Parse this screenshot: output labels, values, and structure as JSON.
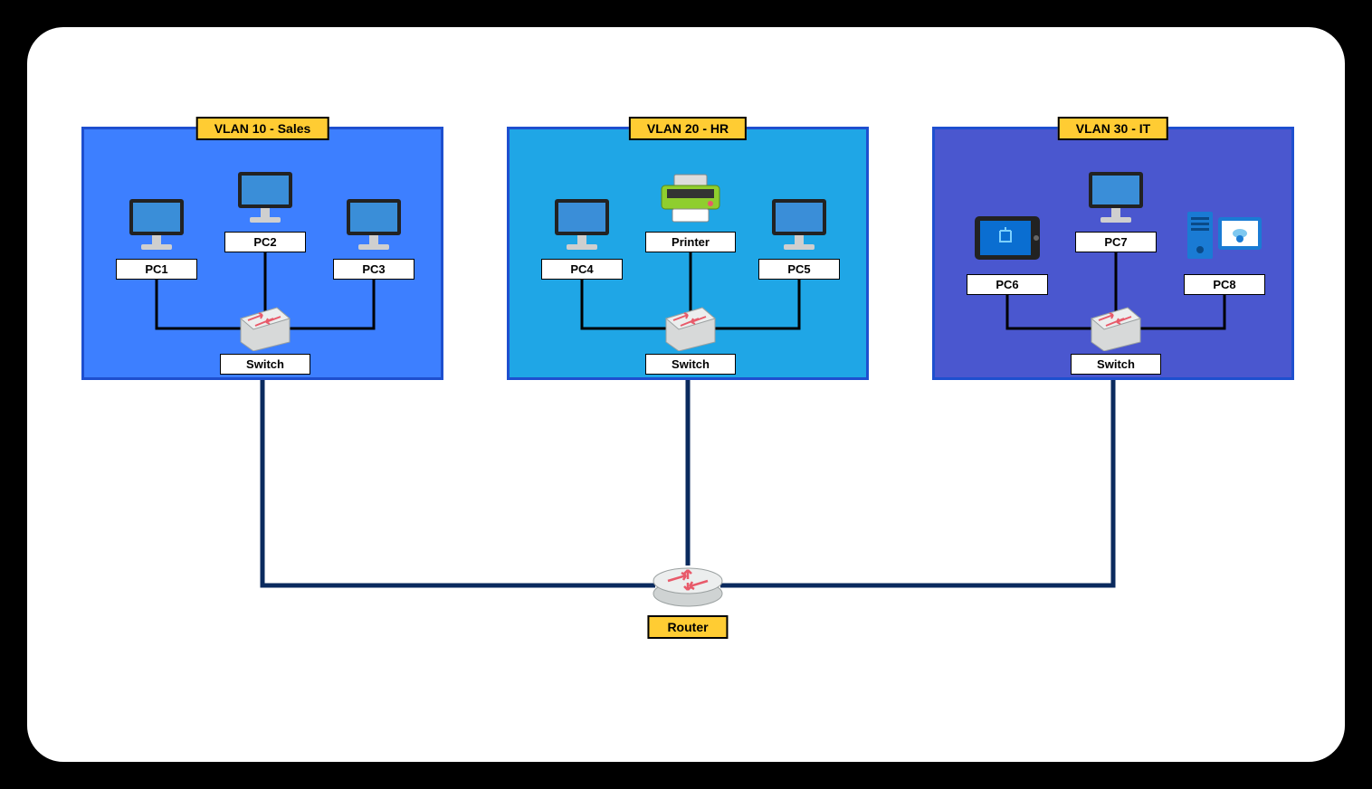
{
  "diagram": {
    "router_label": "Router",
    "vlans": [
      {
        "title": "VLAN 10 - Sales",
        "switch_label": "Switch",
        "devices": [
          {
            "label": "PC1",
            "type": "pc"
          },
          {
            "label": "PC2",
            "type": "pc"
          },
          {
            "label": "PC3",
            "type": "pc"
          }
        ]
      },
      {
        "title": "VLAN 20 - HR",
        "switch_label": "Switch",
        "devices": [
          {
            "label": "PC4",
            "type": "pc"
          },
          {
            "label": "Printer",
            "type": "printer"
          },
          {
            "label": "PC5",
            "type": "pc"
          }
        ]
      },
      {
        "title": "VLAN 30 - IT",
        "switch_label": "Switch",
        "devices": [
          {
            "label": "PC6",
            "type": "tablet"
          },
          {
            "label": "PC7",
            "type": "pc"
          },
          {
            "label": "PC8",
            "type": "server"
          }
        ]
      }
    ]
  },
  "colors": {
    "vlan1_fill": "#3d7fff",
    "vlan2_fill": "#1fa6e6",
    "vlan3_fill": "#4a57cf",
    "vlan_border": "#1e4fcf",
    "title_bg": "#ffcc33",
    "trunk_line": "#0a2a5e"
  }
}
